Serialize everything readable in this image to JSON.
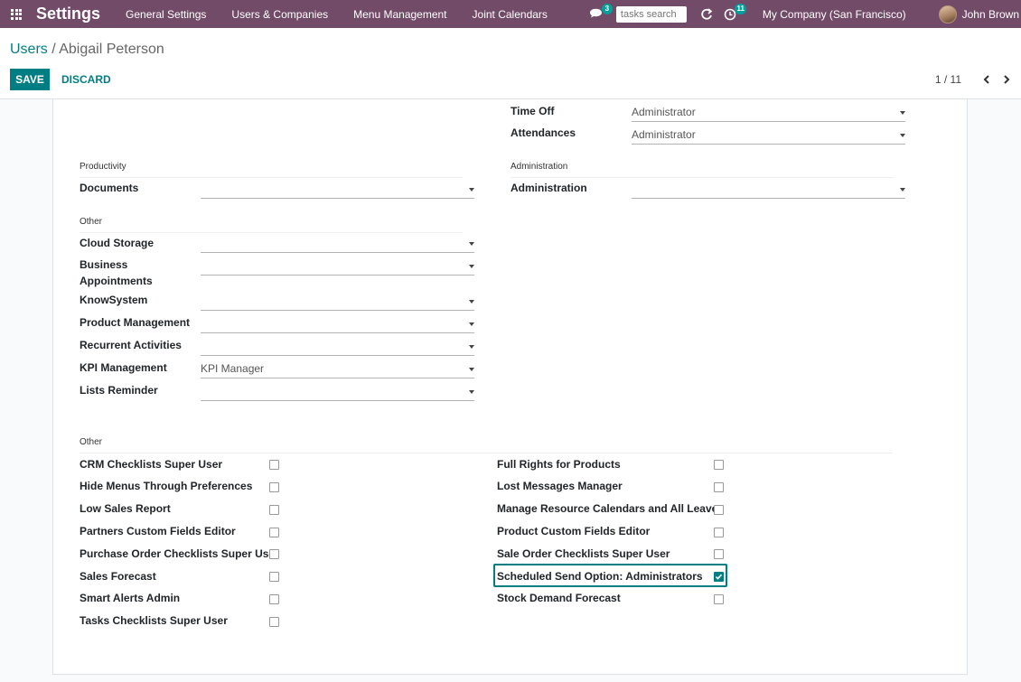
{
  "navbar": {
    "app_title": "Settings",
    "menu": [
      "General Settings",
      "Users & Companies",
      "Menu Management",
      "Joint Calendars"
    ],
    "messages_badge": "3",
    "search_placeholder": "tasks search",
    "activities_badge": "11",
    "company": "My Company (San Francisco)",
    "user": "John Brown"
  },
  "breadcrumb": {
    "parent": "Users",
    "separator": " / ",
    "current": "Abigail Peterson"
  },
  "buttons": {
    "save": "SAVE",
    "discard": "DISCARD"
  },
  "pager": {
    "value": "1 / 11"
  },
  "top_fields": [
    {
      "label": "Time Off",
      "value": "Administrator"
    },
    {
      "label": "Attendances",
      "value": "Administrator"
    }
  ],
  "productivity": {
    "title": "Productivity",
    "fields": [
      {
        "label": "Documents",
        "value": ""
      }
    ]
  },
  "administration": {
    "title": "Administration",
    "fields": [
      {
        "label": "Administration",
        "value": ""
      }
    ]
  },
  "other_apps": {
    "title": "Other",
    "fields": [
      {
        "label": "Cloud Storage",
        "value": ""
      },
      {
        "label": "Business Appointments",
        "value": ""
      },
      {
        "label": "KnowSystem",
        "value": ""
      },
      {
        "label": "Product Management",
        "value": ""
      },
      {
        "label": "Recurrent Activities",
        "value": ""
      },
      {
        "label": "KPI Management",
        "value": "KPI Manager"
      },
      {
        "label": "Lists Reminder",
        "value": ""
      }
    ]
  },
  "other_rights": {
    "title": "Other",
    "left": [
      {
        "label": "CRM Checklists Super User",
        "checked": false
      },
      {
        "label": "Hide Menus Through Preferences",
        "checked": false
      },
      {
        "label": "Low Sales Report",
        "checked": false
      },
      {
        "label": "Partners Custom Fields Editor",
        "checked": false
      },
      {
        "label": "Purchase Order Checklists Super User",
        "checked": false
      },
      {
        "label": "Sales Forecast",
        "checked": false
      },
      {
        "label": "Smart Alerts Admin",
        "checked": false
      },
      {
        "label": "Tasks Checklists Super User",
        "checked": false
      }
    ],
    "right": [
      {
        "label": "Full Rights for Products",
        "checked": false
      },
      {
        "label": "Lost Messages Manager",
        "checked": false
      },
      {
        "label": "Manage Resource Calendars and All Leaves",
        "checked": false
      },
      {
        "label": "Product Custom Fields Editor",
        "checked": false
      },
      {
        "label": "Sale Order Checklists Super User",
        "checked": false
      },
      {
        "label": "Scheduled Send Option: Administrators",
        "checked": true
      },
      {
        "label": "Stock Demand Forecast",
        "checked": false
      }
    ]
  },
  "colors": {
    "navbar": "#714b67",
    "primary": "#017e84",
    "badge": "#00a09d"
  }
}
